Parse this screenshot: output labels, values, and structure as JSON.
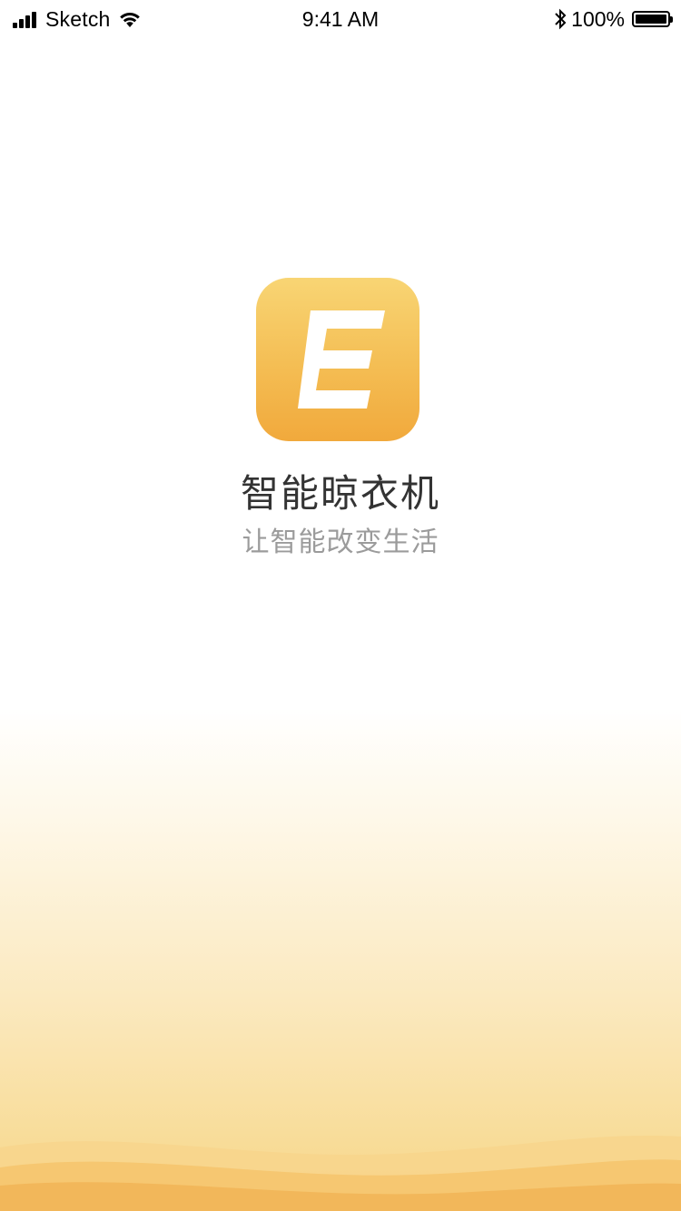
{
  "status_bar": {
    "carrier": "Sketch",
    "time": "9:41 AM",
    "battery_percent_label": "100%",
    "battery_level": 1.0
  },
  "splash": {
    "icon_letter": "E",
    "title": "智能晾衣机",
    "slogan": "让智能改变生活"
  },
  "colors": {
    "icon_gradient_top": "#f8d574",
    "icon_gradient_bottom": "#f1a93c",
    "title": "#333333",
    "slogan": "#9b9b9b",
    "wave_light": "#f7d48b",
    "wave_dark": "#f2b65a"
  },
  "icons": {
    "signal": "cellular-signal-icon",
    "wifi": "wifi-icon",
    "bluetooth": "bluetooth-icon",
    "battery": "battery-icon"
  }
}
